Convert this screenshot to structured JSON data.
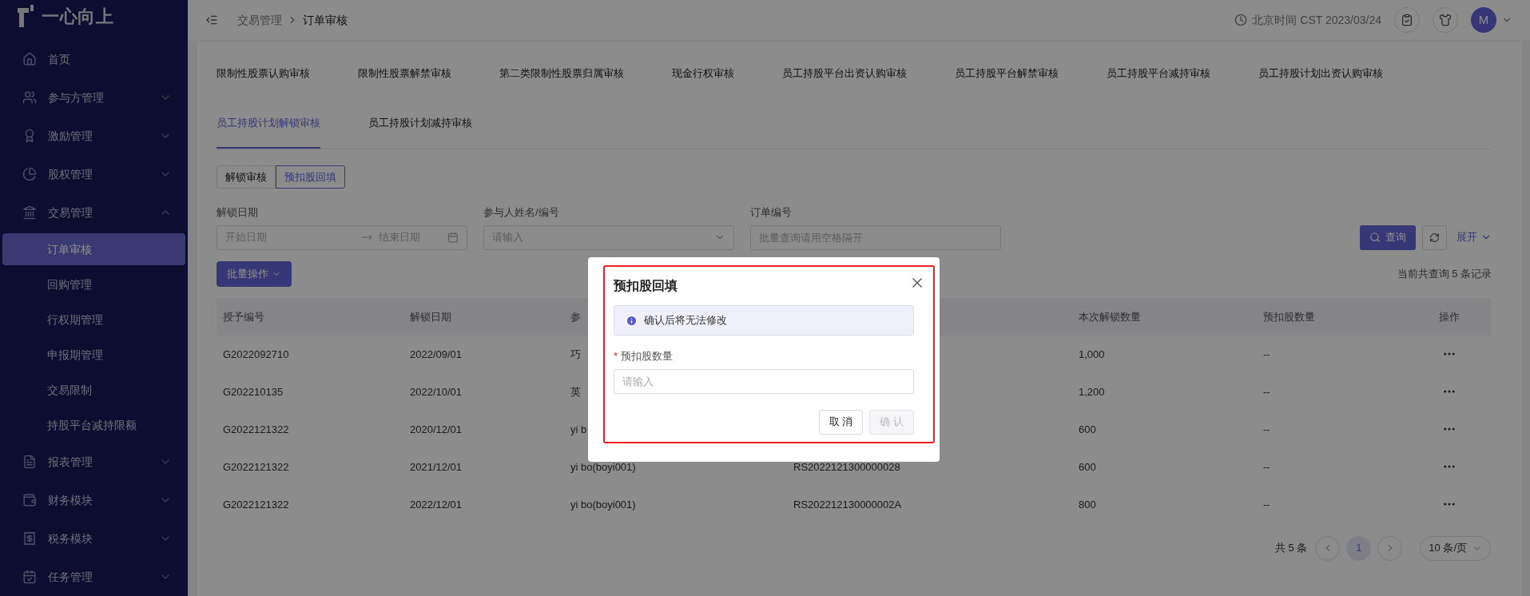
{
  "sidebar": {
    "logo": "一心向上",
    "items": [
      {
        "label": "首页",
        "kind": "link"
      },
      {
        "label": "参与方管理",
        "kind": "group",
        "expanded": false
      },
      {
        "label": "激励管理",
        "kind": "group",
        "expanded": false
      },
      {
        "label": "股权管理",
        "kind": "group",
        "expanded": false
      },
      {
        "label": "交易管理",
        "kind": "group",
        "expanded": true,
        "children": [
          {
            "label": "订单审核",
            "selected": true
          },
          {
            "label": "回购管理",
            "selected": false
          },
          {
            "label": "行权期管理",
            "selected": false
          },
          {
            "label": "申报期管理",
            "selected": false
          },
          {
            "label": "交易限制",
            "selected": false
          },
          {
            "label": "持股平台减持限额",
            "selected": false
          }
        ]
      },
      {
        "label": "报表管理",
        "kind": "group",
        "expanded": false
      },
      {
        "label": "财务模块",
        "kind": "group",
        "expanded": false
      },
      {
        "label": "税务模块",
        "kind": "group",
        "expanded": false
      },
      {
        "label": "任务管理",
        "kind": "group",
        "expanded": false
      }
    ]
  },
  "topbar": {
    "breadcrumb": [
      "交易管理",
      "订单审核"
    ],
    "clock": "北京时间 CST 2023/03/24",
    "avatar": "M"
  },
  "tabs": [
    {
      "label": "限制性股票认购审核",
      "selected": false
    },
    {
      "label": "限制性股票解禁审核",
      "selected": false
    },
    {
      "label": "第二类限制性股票归属审核",
      "selected": false
    },
    {
      "label": "现金行权审核",
      "selected": false
    },
    {
      "label": "员工持股平台出资认购审核",
      "selected": false
    },
    {
      "label": "员工持股平台解禁审核",
      "selected": false
    },
    {
      "label": "员工持股平台减持审核",
      "selected": false
    },
    {
      "label": "员工持股计划出资认购审核",
      "selected": false
    },
    {
      "label": "员工持股计划解锁审核",
      "selected": true
    },
    {
      "label": "员工持股计划减持审核",
      "selected": false
    }
  ],
  "segments": [
    {
      "label": "解锁审核",
      "selected": false
    },
    {
      "label": "预扣股回填",
      "selected": true
    }
  ],
  "filters": [
    {
      "label": "解锁日期",
      "kind": "date_range",
      "start_placeholder": "开始日期",
      "end_placeholder": "结束日期"
    },
    {
      "label": "参与人姓名/编号",
      "kind": "select",
      "placeholder": "请输入"
    },
    {
      "label": "订单编号",
      "kind": "text",
      "placeholder": "批量查询请用空格隔开"
    }
  ],
  "search_button": "查询",
  "expand_link": "展开",
  "batch_button": "批量操作",
  "record_count": "当前共查询 5 条记录",
  "table": {
    "columns": [
      "授予编号",
      "解锁日期",
      "参",
      null,
      "本次解锁数量",
      "预扣股数量",
      "操作"
    ],
    "rows": [
      [
        "G2022092710",
        "2022/09/01",
        "巧",
        null,
        "1,000",
        "--"
      ],
      [
        "G202210135",
        "2022/10/01",
        "英",
        null,
        "1,200",
        "--"
      ],
      [
        "G2022121322",
        "2020/12/01",
        "yi b",
        null,
        "600",
        "--"
      ],
      [
        "G2022121322",
        "2021/12/01",
        "yi bo(boyi001)",
        "RS2022121300000028",
        "600",
        "--"
      ],
      [
        "G2022121322",
        "2022/12/01",
        "yi bo(boyi001)",
        "RS202212130000002A",
        "800",
        "--"
      ]
    ]
  },
  "pagination": {
    "total": "共 5 条",
    "pages": [
      {
        "label": "1",
        "selected": true
      }
    ],
    "page_size": "10 条/页"
  },
  "modal": {
    "title": "预扣股回填",
    "notice": "确认后将无法修改",
    "field": {
      "label": "预扣股数量",
      "required_mark": "*",
      "placeholder": "请输入"
    },
    "buttons": [
      {
        "label": "取 消",
        "disabled": false
      },
      {
        "label": "确 认",
        "disabled": true
      }
    ]
  }
}
